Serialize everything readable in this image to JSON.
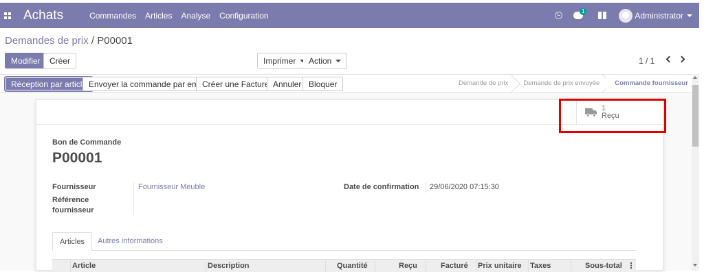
{
  "navbar": {
    "app_title": "Achats",
    "menu": [
      "Commandes",
      "Articles",
      "Analyse",
      "Configuration"
    ],
    "chat_badge": "1",
    "user": "Administrator",
    "bg_color": "#7c7bad"
  },
  "breadcrumb": {
    "parent": "Demandes de prix",
    "separator": "/",
    "current": "P00001"
  },
  "toolbar": {
    "edit_label": "Modifier",
    "create_label": "Créer",
    "print_label": "Imprimer",
    "action_label": "Action",
    "pager": "1 / 1"
  },
  "statusbar": {
    "buttons": [
      "Réception par article",
      "Envoyer la commande par email",
      "Créer une Facture",
      "Annuler",
      "Bloquer"
    ],
    "stages": [
      "Demande de prix",
      "Demande de prix envoyée",
      "Commande fournisseur"
    ],
    "active_stage": "Commande fournisseur"
  },
  "smart_button": {
    "value": "1",
    "label": "Reçu",
    "icon": "truck-icon"
  },
  "form": {
    "doc_type_label": "Bon de Commande",
    "doc_name": "P00001",
    "supplier_label": "Fournisseur",
    "supplier_value": "Fournisseur Meuble",
    "supplier_ref_label_1": "Référence",
    "supplier_ref_label_2": "fournisseur",
    "confirm_date_label": "Date de confirmation",
    "confirm_date_value": "29/06/2020 07:15:30"
  },
  "tabs": [
    "Articles",
    "Autres informations"
  ],
  "table": {
    "columns": [
      "Article",
      "Description",
      "Quantité",
      "Reçu",
      "Facturé",
      "Prix unitaire",
      "Taxes",
      "Sous-total"
    ]
  },
  "colors": {
    "accent": "#7c7bad",
    "highlight": "#e00000"
  }
}
